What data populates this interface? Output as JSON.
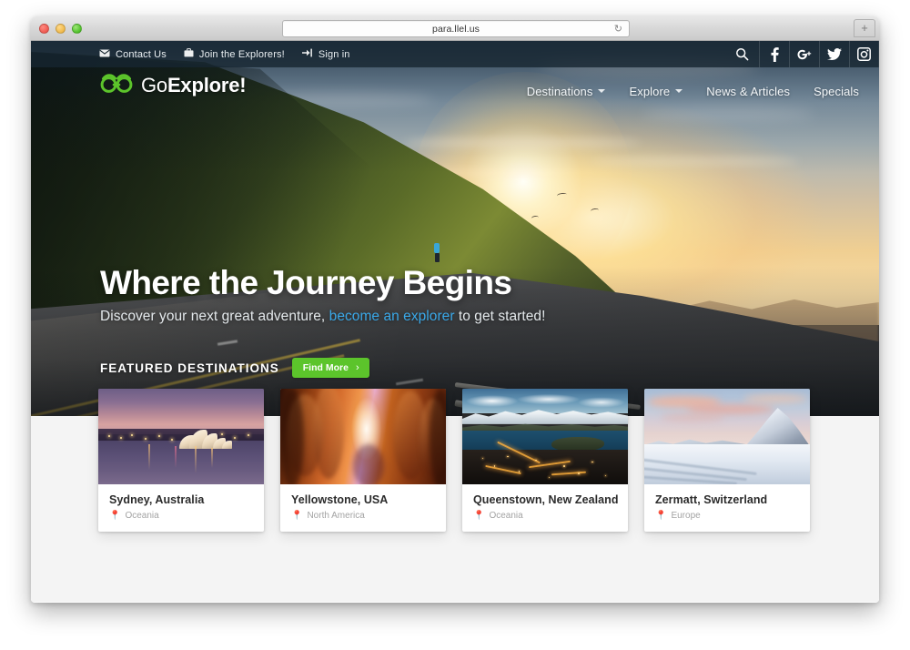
{
  "browser": {
    "url": "para.llel.us",
    "reload_icon": "reload-icon",
    "new_tab_label": "+",
    "traffic_lights": [
      "close-red",
      "minimize-yellow",
      "zoom-green"
    ]
  },
  "topbar": {
    "links": [
      {
        "label": "Contact Us",
        "icon": "envelope-icon"
      },
      {
        "label": "Join the Explorers!",
        "icon": "briefcase-icon"
      },
      {
        "label": "Sign in",
        "icon": "sign-in-icon"
      }
    ],
    "search_icon": "search-icon",
    "social": [
      {
        "name": "facebook-icon",
        "glyph": "f"
      },
      {
        "name": "google-plus-icon",
        "glyph": "g+"
      },
      {
        "name": "twitter-icon",
        "glyph": "twitter"
      },
      {
        "name": "instagram-icon",
        "glyph": "instagram"
      }
    ]
  },
  "brand": {
    "icon": "binoculars-logo-icon",
    "name_light": "Go",
    "name_bold": "Explore!",
    "accent_color": "#5cc42b"
  },
  "nav": {
    "items": [
      {
        "label": "Destinations",
        "has_dropdown": true
      },
      {
        "label": "Explore",
        "has_dropdown": true
      },
      {
        "label": "News & Articles",
        "has_dropdown": false
      },
      {
        "label": "Specials",
        "has_dropdown": false
      }
    ]
  },
  "hero": {
    "title": "Where the Journey Begins",
    "subtitle_before": "Discover your next great adventure, ",
    "subtitle_link": "become an explorer",
    "subtitle_after": " to get started!",
    "link_color": "#3aa8e8"
  },
  "featured": {
    "heading": "FEATURED DESTINATIONS",
    "button_label": "Find More",
    "button_chevron": "›",
    "button_color": "#5cc42b",
    "cards": [
      {
        "title": "Sydney, Australia",
        "region": "Oceania",
        "pin_icon": "map-pin-icon"
      },
      {
        "title": "Yellowstone, USA",
        "region": "North America",
        "pin_icon": "map-pin-icon"
      },
      {
        "title": "Queenstown, New Zealand",
        "region": "Oceania",
        "pin_icon": "map-pin-icon"
      },
      {
        "title": "Zermatt, Switzerland",
        "region": "Europe",
        "pin_icon": "map-pin-icon"
      }
    ]
  }
}
